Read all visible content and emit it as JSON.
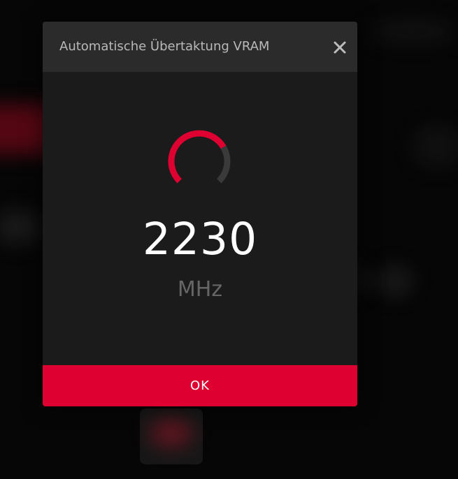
{
  "dialog": {
    "title": "Automatische Übertaktung VRAM",
    "close_icon": "close-icon",
    "progress": {
      "fraction": 0.72,
      "accent_color": "#de0030",
      "track_color": "#3a3a3a"
    },
    "value": "2230",
    "unit": "MHz",
    "ok_label": "OK"
  },
  "colors": {
    "accent": "#de0030",
    "header_bg": "#2b2b2b",
    "dialog_bg": "#1b1b1b"
  }
}
